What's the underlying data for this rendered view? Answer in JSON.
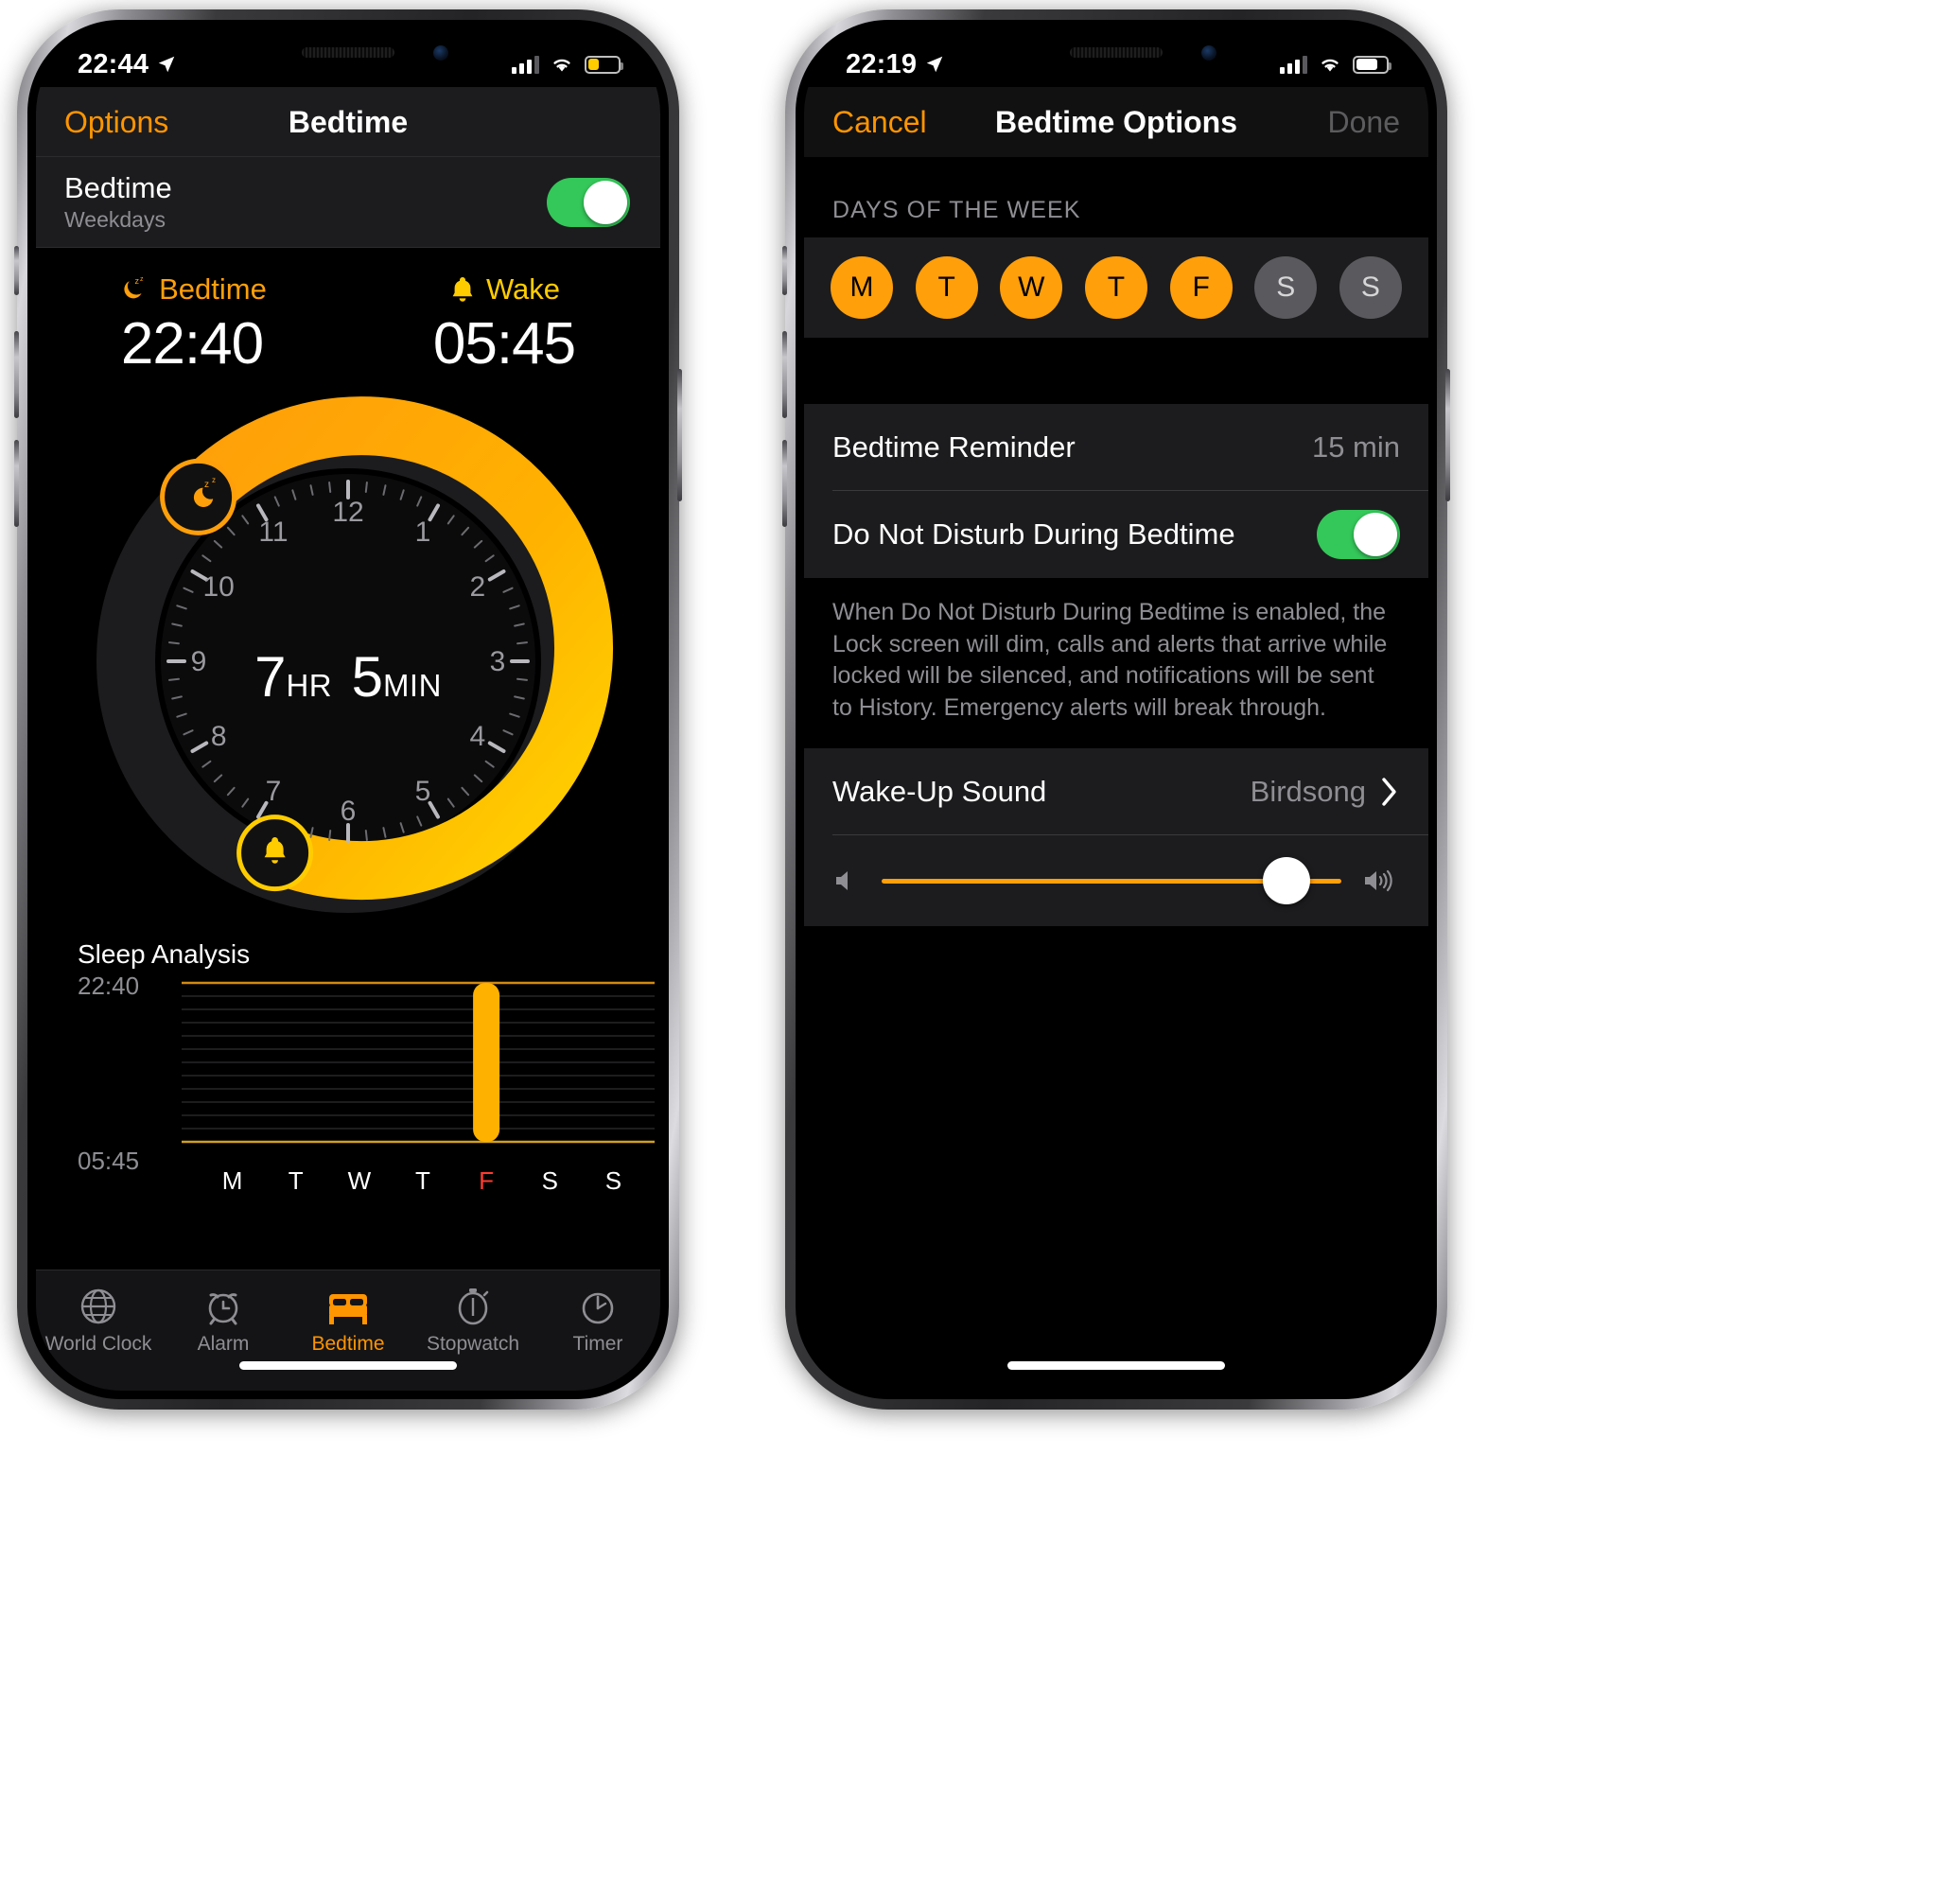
{
  "colors": {
    "accent_orange": "#ff9500",
    "dial_orange": "#ff9f0a",
    "dial_yellow": "#ffcc00",
    "green": "#34c759",
    "today_red": "#ff3b30",
    "gray": "#8e8e93"
  },
  "left_phone": {
    "status": {
      "time": "22:44",
      "location_icon": "location-arrow-icon",
      "signal_icon": "cellular-bars-icon",
      "wifi_icon": "wifi-icon",
      "battery_icon": "battery-low-icon"
    },
    "nav": {
      "left_button": "Options",
      "title": "Bedtime"
    },
    "bedtime_row": {
      "title": "Bedtime",
      "subtitle": "Weekdays",
      "toggle_on": true
    },
    "bedtime": {
      "label": "Bedtime",
      "icon": "moon-zzz-icon",
      "time": "22:40"
    },
    "wake": {
      "label": "Wake",
      "icon": "bell-icon",
      "time": "05:45"
    },
    "duration": {
      "hours": "7",
      "hours_unit": "HR",
      "minutes": "5",
      "minutes_unit": "MIN"
    },
    "dial": {
      "numbers": [
        "12",
        "1",
        "2",
        "3",
        "4",
        "5",
        "6",
        "7",
        "8",
        "9",
        "10",
        "11"
      ],
      "bedtime_handle_icon": "moon-zzz-handle-icon",
      "wake_handle_icon": "bell-handle-icon"
    },
    "sleep_analysis": {
      "title": "Sleep Analysis",
      "top_label": "22:40",
      "bottom_label": "05:45",
      "days": [
        "M",
        "T",
        "W",
        "T",
        "F",
        "S",
        "S"
      ],
      "today_index": 4
    },
    "tabs": [
      {
        "label": "World Clock",
        "icon": "globe-icon",
        "active": false
      },
      {
        "label": "Alarm",
        "icon": "alarm-clock-icon",
        "active": false
      },
      {
        "label": "Bedtime",
        "icon": "bed-icon",
        "active": true
      },
      {
        "label": "Stopwatch",
        "icon": "stopwatch-icon",
        "active": false
      },
      {
        "label": "Timer",
        "icon": "timer-icon",
        "active": false
      }
    ]
  },
  "right_phone": {
    "status": {
      "time": "22:19",
      "location_icon": "location-arrow-icon",
      "signal_icon": "cellular-bars-icon",
      "wifi_icon": "wifi-icon",
      "battery_icon": "battery-icon"
    },
    "nav": {
      "left_button": "Cancel",
      "title": "Bedtime Options",
      "right_button": "Done"
    },
    "days_section": {
      "header": "DAYS OF THE WEEK",
      "days": [
        {
          "letter": "M",
          "selected": true
        },
        {
          "letter": "T",
          "selected": true
        },
        {
          "letter": "W",
          "selected": true
        },
        {
          "letter": "T",
          "selected": true
        },
        {
          "letter": "F",
          "selected": true
        },
        {
          "letter": "S",
          "selected": false
        },
        {
          "letter": "S",
          "selected": false
        }
      ]
    },
    "reminder_row": {
      "label": "Bedtime Reminder",
      "value": "15 min"
    },
    "dnd_row": {
      "label": "Do Not Disturb During Bedtime",
      "toggle_on": true
    },
    "dnd_note": "When Do Not Disturb During Bedtime is enabled, the Lock screen will dim, calls and alerts that arrive while locked will be silenced, and notifications will be sent to History. Emergency alerts will break through.",
    "wake_sound_row": {
      "label": "Wake-Up Sound",
      "value": "Birdsong",
      "chevron_icon": "chevron-right-icon"
    },
    "volume": {
      "low_icon": "volume-low-icon",
      "high_icon": "volume-high-icon",
      "percent": 88
    }
  },
  "chart_data": {
    "type": "bar",
    "title": "Sleep Analysis",
    "categories": [
      "M",
      "T",
      "W",
      "T",
      "F",
      "S",
      "S"
    ],
    "values": [
      0,
      0,
      0,
      0,
      100,
      0,
      0
    ],
    "ylabel": "",
    "xlabel": "",
    "ytick_labels": [
      "22:40",
      "05:45"
    ],
    "ylim": [
      0,
      100
    ],
    "grid": true,
    "highlight_category": "F",
    "legend": "none"
  }
}
